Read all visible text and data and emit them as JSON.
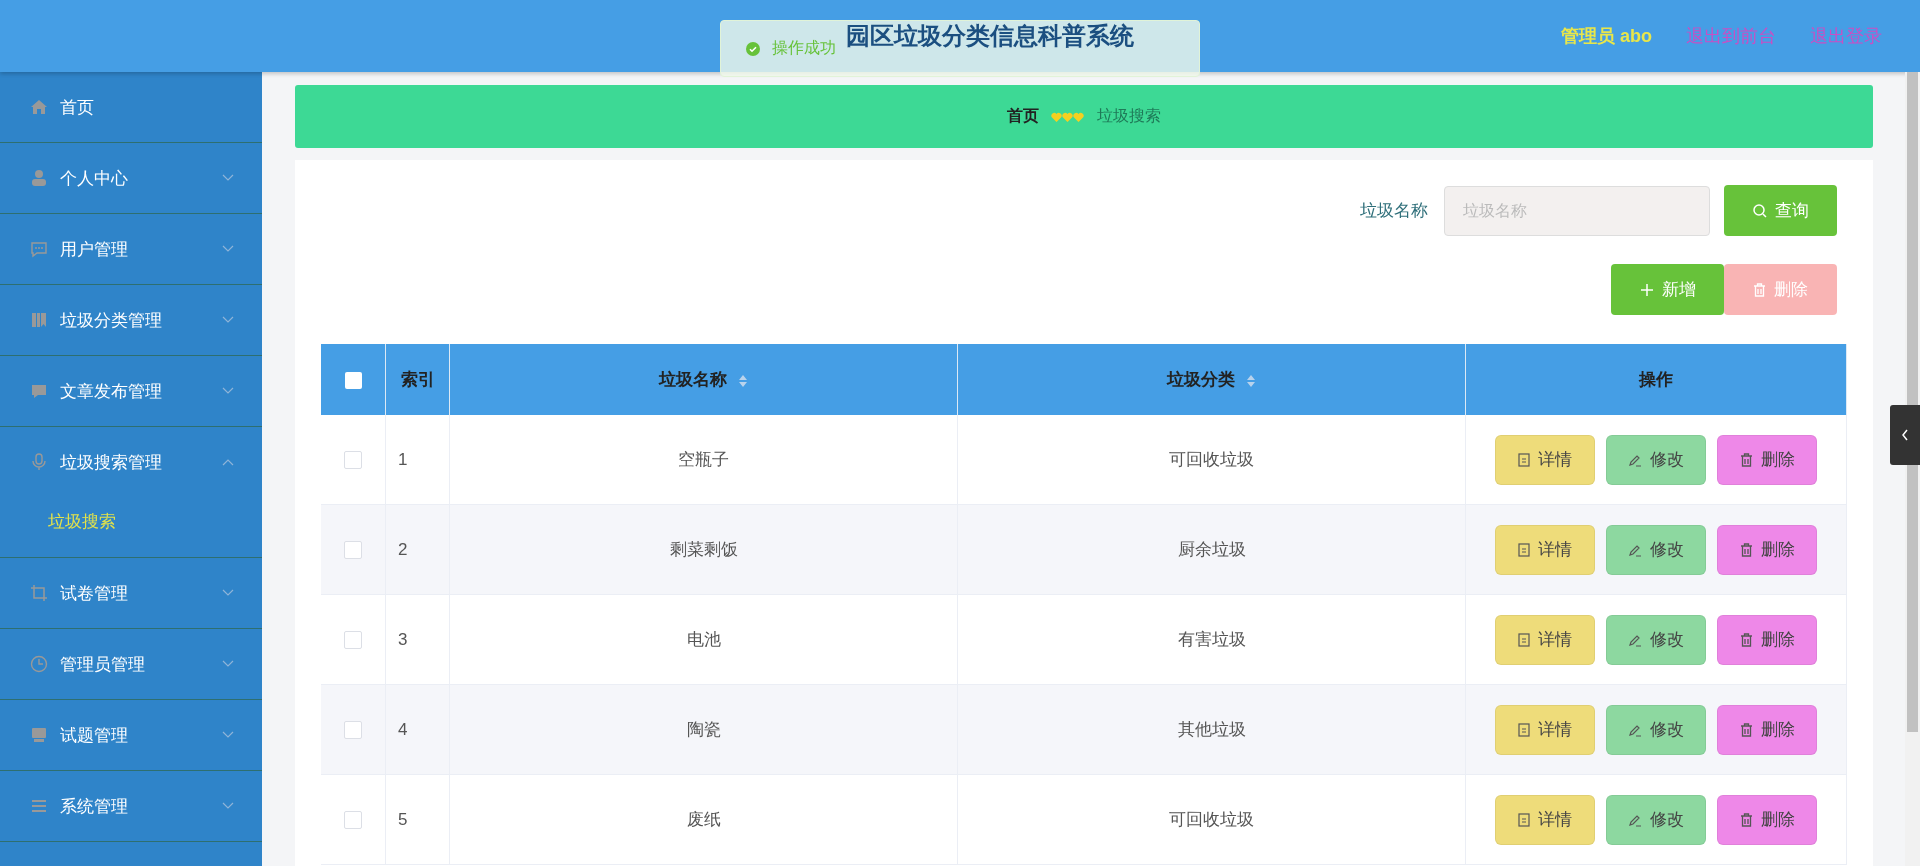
{
  "header": {
    "title": "园区垃圾分类信息科普系统",
    "user": "管理员 abo",
    "links": [
      "退出到前台",
      "退出登录"
    ]
  },
  "toast": {
    "kind": "success",
    "message": "操作成功"
  },
  "sidebar": {
    "items": [
      {
        "label": "首页",
        "kind": "link"
      },
      {
        "label": "个人中心",
        "kind": "menu",
        "expanded": false
      },
      {
        "label": "用户管理",
        "kind": "menu",
        "expanded": false
      },
      {
        "label": "垃圾分类管理",
        "kind": "menu",
        "expanded": false
      },
      {
        "label": "文章发布管理",
        "kind": "menu",
        "expanded": false
      },
      {
        "label": "垃圾搜索管理",
        "kind": "menu",
        "expanded": true,
        "children": [
          {
            "label": "垃圾搜索",
            "selected": true
          }
        ]
      },
      {
        "label": "试卷管理",
        "kind": "menu",
        "expanded": false
      },
      {
        "label": "管理员管理",
        "kind": "menu",
        "expanded": false
      },
      {
        "label": "试题管理",
        "kind": "menu",
        "expanded": false
      },
      {
        "label": "系统管理",
        "kind": "menu",
        "expanded": false
      }
    ]
  },
  "breadcrumb": [
    "首页",
    "垃圾搜索"
  ],
  "search": {
    "label": "垃圾名称",
    "placeholder": "垃圾名称",
    "button": "查询"
  },
  "actions": [
    {
      "label": "新增",
      "kind": "add",
      "disabled": false
    },
    {
      "label": "删除",
      "kind": "delete",
      "disabled": true
    }
  ],
  "table": {
    "select_all": {
      "checked": false
    },
    "columns": [
      {
        "label": "索引",
        "sortable": false
      },
      {
        "label": "垃圾名称",
        "sortable": true
      },
      {
        "label": "垃圾分类",
        "sortable": true
      },
      {
        "label": "操作",
        "sortable": false
      }
    ],
    "rows": [
      {
        "checked": false,
        "index": "1",
        "name": "空瓶子",
        "category": "可回收垃圾",
        "actions": [
          {
            "kind": "detail",
            "label": "详情"
          },
          {
            "kind": "edit",
            "label": "修改"
          },
          {
            "kind": "delete",
            "label": "删除"
          }
        ]
      },
      {
        "checked": false,
        "index": "2",
        "name": "剩菜剩饭",
        "category": "厨余垃圾",
        "actions": [
          {
            "kind": "detail",
            "label": "详情"
          },
          {
            "kind": "edit",
            "label": "修改"
          },
          {
            "kind": "delete",
            "label": "删除"
          }
        ]
      },
      {
        "checked": false,
        "index": "3",
        "name": "电池",
        "category": "有害垃圾",
        "actions": [
          {
            "kind": "detail",
            "label": "详情"
          },
          {
            "kind": "edit",
            "label": "修改"
          },
          {
            "kind": "delete",
            "label": "删除"
          }
        ]
      },
      {
        "checked": false,
        "index": "4",
        "name": "陶瓷",
        "category": "其他垃圾",
        "actions": [
          {
            "kind": "detail",
            "label": "详情"
          },
          {
            "kind": "edit",
            "label": "修改"
          },
          {
            "kind": "delete",
            "label": "删除"
          }
        ]
      },
      {
        "checked": false,
        "index": "5",
        "name": "废纸",
        "category": "可回收垃圾",
        "actions": [
          {
            "kind": "detail",
            "label": "详情"
          },
          {
            "kind": "edit",
            "label": "修改"
          },
          {
            "kind": "delete",
            "label": "删除"
          }
        ]
      }
    ]
  }
}
